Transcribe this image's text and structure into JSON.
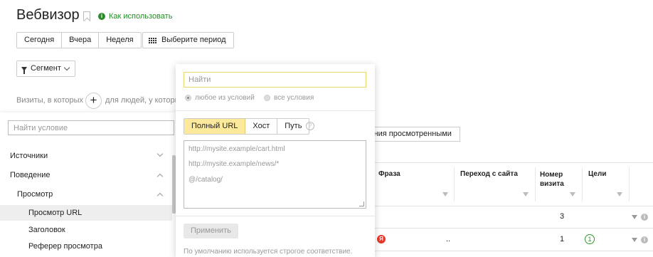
{
  "header": {
    "title": "Вебвизор",
    "howto_label": "Как использовать",
    "howto_icon": "i"
  },
  "date_buttons": [
    "Сегодня",
    "Вчера",
    "Неделя"
  ],
  "period_button": "Выберите период",
  "segment_button": "Сегмент",
  "filter_row": {
    "visits_text": "Визиты, в которых",
    "add_symbol": "+",
    "for_people_text": "для людей, у которы"
  },
  "condition_panel": {
    "search_placeholder": "Найти условие",
    "items": [
      "Источники",
      "Поведение",
      "Просмотр",
      "Просмотр URL",
      "Заголовок",
      "Реферер просмотра"
    ]
  },
  "url_popup": {
    "search_placeholder": "Найти",
    "radio_any": "любое из условий",
    "radio_all": "все условия",
    "tabs": [
      "Полный URL",
      "Хост",
      "Путь"
    ],
    "help_symbol": "?",
    "textarea_lines": [
      "http://mysite.example/cart.html",
      "http://mysite.example/news/*",
      "@/catalog/"
    ],
    "apply_label": "Применить",
    "note": "По умолчанию используется строгое соответствие."
  },
  "viewed_button": "дения просмотренными",
  "table": {
    "columns": [
      "Фраза",
      "Переход с сайта",
      "Номер визита",
      "Цели"
    ],
    "rows": [
      {
        "phrase_icon": "",
        "phrase": "",
        "referrer": "",
        "visit_number": "3",
        "goals": ""
      },
      {
        "phrase_icon": "Я",
        "phrase": "..",
        "referrer": "",
        "visit_number": "1",
        "goals": "1"
      }
    ],
    "info_symbol": "i"
  },
  "colors": {
    "accent_green": "#2a8a2a",
    "active_tab": "#fde99c",
    "yandex_red": "#e6372a"
  }
}
